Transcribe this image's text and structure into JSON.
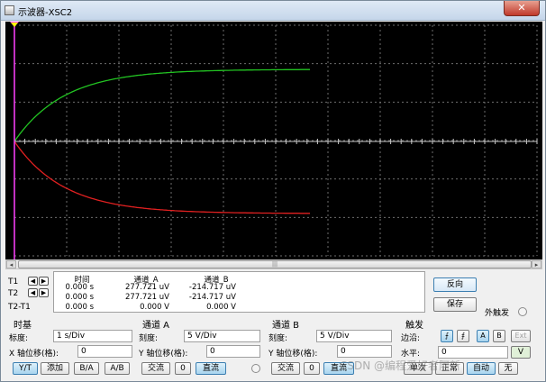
{
  "window": {
    "title": "示波器-XSC2",
    "close_label": "✕"
  },
  "scope": {
    "background": "#000000",
    "grid_color": "#6e6e6e",
    "axis_color": "#c8c8c8",
    "channel_a_color": "#22c322",
    "channel_b_color": "#e02020",
    "t1_cursor_color": "#ff40ff",
    "t2_cursor_color": "#ffff00"
  },
  "cursors": {
    "t1": "T1",
    "t2": "T2",
    "t2_t1": "T2-T1",
    "left_arrow": "◀",
    "right_arrow": "▶"
  },
  "readout": {
    "headers": [
      "时间",
      "通道_A",
      "通道_B"
    ],
    "rows": [
      [
        "0.000 s",
        "277.721 uV",
        "-214.717 uV"
      ],
      [
        "0.000 s",
        "277.721 uV",
        "-214.717 uV"
      ],
      [
        "0.000 s",
        "0.000 V",
        "0.000 V"
      ]
    ]
  },
  "buttons": {
    "reverse": "反向",
    "save": "保存",
    "ext_trigger": "外触发"
  },
  "timebase": {
    "title": "时基",
    "scale_label": "标度:",
    "scale_value": "1 s/Div",
    "xpos_label": "X 轴位移(格):",
    "xpos_value": "0",
    "modes": [
      "Y/T",
      "添加",
      "B/A",
      "A/B"
    ],
    "selected_mode": "Y/T"
  },
  "channel_a": {
    "title": "通道 A",
    "scale_label": "刻度:",
    "scale_value": "5 V/Div",
    "ypos_label": "Y 轴位移(格):",
    "ypos_value": "0",
    "coupling": [
      "交流",
      "0",
      "直流"
    ],
    "selected_coupling": "直流"
  },
  "channel_b": {
    "title": "通道 B",
    "scale_label": "刻度:",
    "scale_value": "5 V/Div",
    "ypos_label": "Y 轴位移(格):",
    "ypos_value": "0",
    "coupling": [
      "交流",
      "0",
      "直流"
    ],
    "selected_coupling": "直流"
  },
  "trigger": {
    "title": "触发",
    "edge_label": "边沿:",
    "level_label": "水平:",
    "level_value": "0",
    "level_unit": "V",
    "sources": [
      "A",
      "B",
      "Ext"
    ],
    "selected_source": "A",
    "modes": [
      "单次",
      "正常",
      "自动",
      "无"
    ],
    "selected_mode": "自动"
  },
  "watermark": "CSDN @编程爱好者阿新"
}
